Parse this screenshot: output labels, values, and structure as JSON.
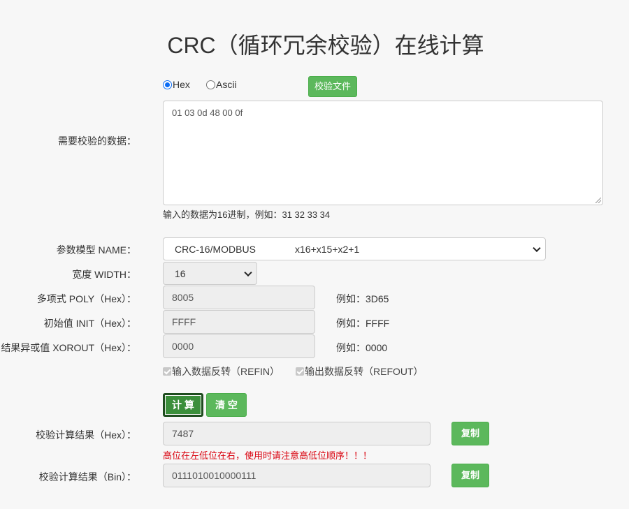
{
  "title": "CRC（循环冗余校验）在线计算",
  "input_mode": {
    "options": [
      "Hex",
      "Ascii"
    ],
    "selected": "Hex",
    "check_file_label": "校验文件"
  },
  "data": {
    "label": "需要校验的数据：",
    "value": "01 03 0d 48 00 0f",
    "hint": "输入的数据为16进制，例如：31 32 33 34"
  },
  "params": {
    "model_label": "参数模型 NAME：",
    "model_value": "CRC-16/MODBUS",
    "model_poly_text": "x16+x15+x2+1",
    "width_label": "宽度 WIDTH：",
    "width_value": "16",
    "poly_label": "多项式 POLY（Hex）：",
    "poly_value": "8005",
    "poly_example": "例如：3D65",
    "init_label": "初始值 INIT（Hex）：",
    "init_value": "FFFF",
    "init_example": "例如：FFFF",
    "xorout_label": "结果异或值 XOROUT（Hex）：",
    "xorout_value": "0000",
    "xorout_example": "例如：0000",
    "refin_label": "输入数据反转（REFIN）",
    "refin_checked": true,
    "refout_label": "输出数据反转（REFOUT）",
    "refout_checked": true
  },
  "actions": {
    "calculate_label": "计 算",
    "clear_label": "清 空"
  },
  "results": {
    "hex_label": "校验计算结果（Hex）：",
    "hex_value": "7487",
    "warning": "高位在左低位在右，使用时请注意高低位顺序！！！",
    "bin_label": "校验计算结果（Bin）：",
    "bin_value": "0111010010000111",
    "copy_label": "复制"
  },
  "colors": {
    "button_green": "#5cb85c",
    "calculate_active": "#3b8f3b",
    "warning_red": "#d9000d"
  }
}
